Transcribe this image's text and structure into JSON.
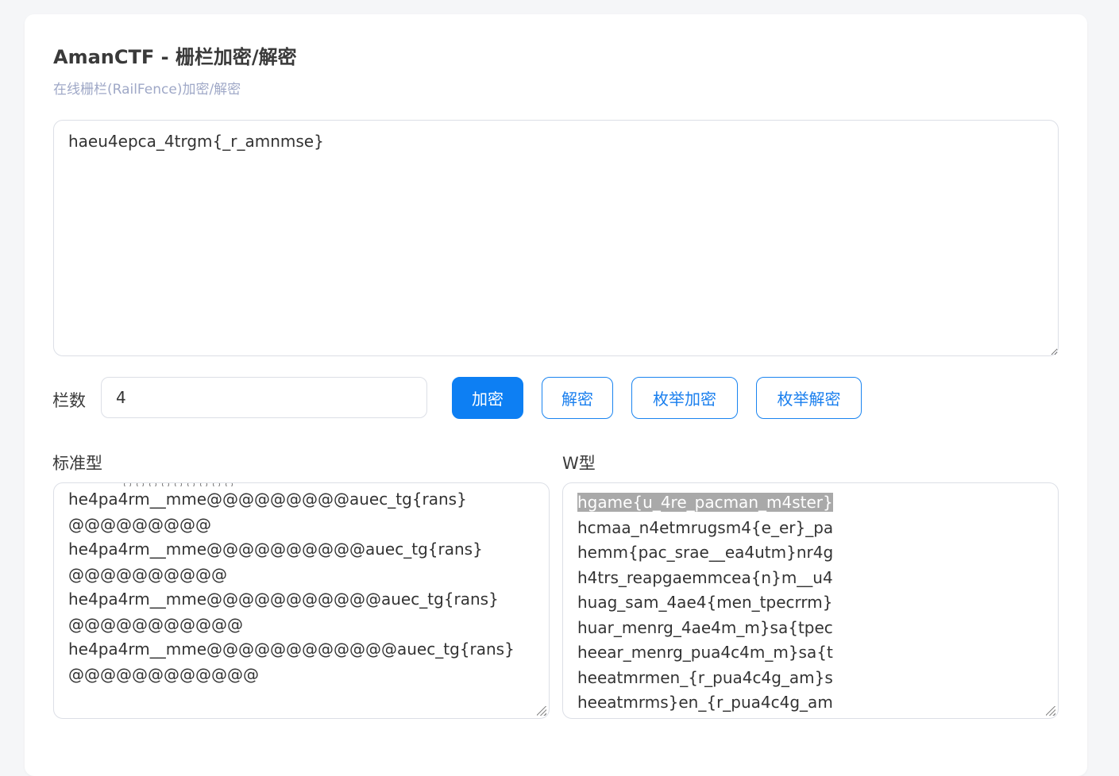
{
  "header": {
    "title": "AmanCTF - 栅栏加密/解密",
    "subtitle": "在线栅栏(RailFence)加密/解密"
  },
  "input": {
    "value": "haeu4epca_4trgm{_r_amnmse}"
  },
  "controls": {
    "rails_label": "栏数",
    "rails_value": "4",
    "encrypt_label": "加密",
    "decrypt_label": "解密",
    "enum_encrypt_label": "枚举加密",
    "enum_decrypt_label": "枚举解密"
  },
  "output": {
    "standard_label": "标准型",
    "w_label": "W型",
    "standard_lines": [
      "he4pa4rm__mme@@@@@@@@@auec_tg{rans}",
      "@@@@@@@@@",
      "he4pa4rm__mme@@@@@@@@@@auec_tg{rans}",
      "@@@@@@@@@@",
      "he4pa4rm__mme@@@@@@@@@@@auec_tg{rans}",
      "@@@@@@@@@@@",
      "he4pa4rm__mme@@@@@@@@@@@@auec_tg{rans}",
      "@@@@@@@@@@@@"
    ],
    "w_lines": [
      "hgame{u_4re_pacman_m4ster}",
      "hcmaa_n4etmrugsm4{e_er}_pa",
      "hemm{pac_srae__ea4utm}nr4g",
      "h4trs_reapgaemmcea{n}m__u4",
      "huag_sam_4ae4{men_tpecrrm}",
      "huar_menrg_4ae4m_m}sa{tpec",
      "heear_menrg_pua4c4m_m}sa{t",
      "heeatmrmen_{r_pua4c4g_am}s",
      "heeatmrms}en_{r_pua4c4g_am"
    ]
  }
}
